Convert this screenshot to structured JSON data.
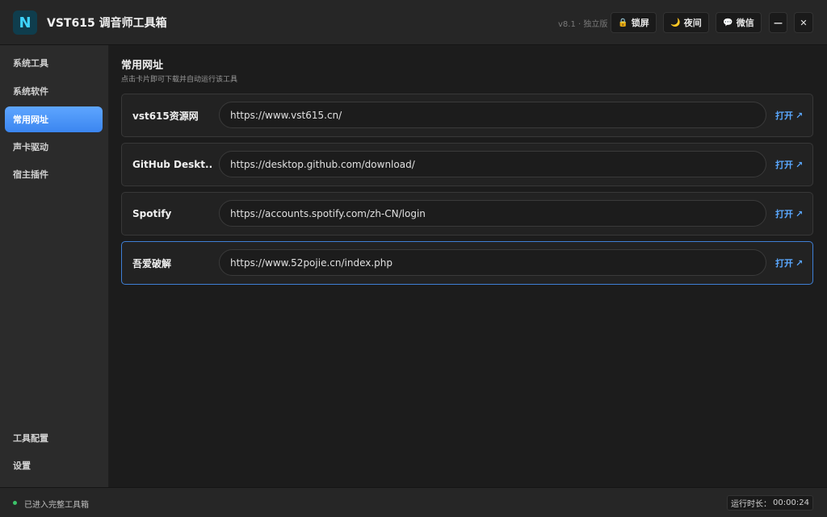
{
  "app": {
    "logo_letter": "N",
    "title": "VST615 调音师工具箱",
    "version": "v8.1 · 独立版"
  },
  "toolbar": {
    "lock": {
      "icon": "lock-icon",
      "glyph": "🔒",
      "label": "锁屏"
    },
    "night": {
      "icon": "moon-icon",
      "glyph": "🌙",
      "label": "夜间"
    },
    "wechat": {
      "icon": "chat-bubble-icon",
      "glyph": "💬",
      "label": "微信"
    },
    "minimize_glyph": "—",
    "close_glyph": "✕"
  },
  "sidebar": {
    "items": [
      {
        "label": "系统工具"
      },
      {
        "label": "系统软件"
      },
      {
        "label": "常用网址",
        "active": true
      },
      {
        "label": "声卡驱动"
      },
      {
        "label": "宿主插件"
      }
    ],
    "bottom_items": [
      {
        "label": "工具配置"
      },
      {
        "label": "设置"
      }
    ]
  },
  "main": {
    "title": "常用网址",
    "subtitle": "点击卡片即可下载并自动运行该工具",
    "open_label": "打开",
    "open_glyph": "↗",
    "cards": [
      {
        "name": "vst615资源网",
        "url": "https://www.vst615.cn/"
      },
      {
        "name": "GitHub Deskt...",
        "url": "https://desktop.github.com/download/"
      },
      {
        "name": "Spotify",
        "url": "https://accounts.spotify.com/zh-CN/login"
      },
      {
        "name": "吾爱破解",
        "url": "https://www.52pojie.cn/index.php",
        "selected": true
      }
    ]
  },
  "status": {
    "text": "已进入完整工具箱",
    "runtime_label": "运行时长：",
    "runtime_value": "00:00:24",
    "dot_color": "#3cc36a"
  },
  "colors": {
    "accent": "#3b86f0",
    "link": "#5aa8ff"
  }
}
